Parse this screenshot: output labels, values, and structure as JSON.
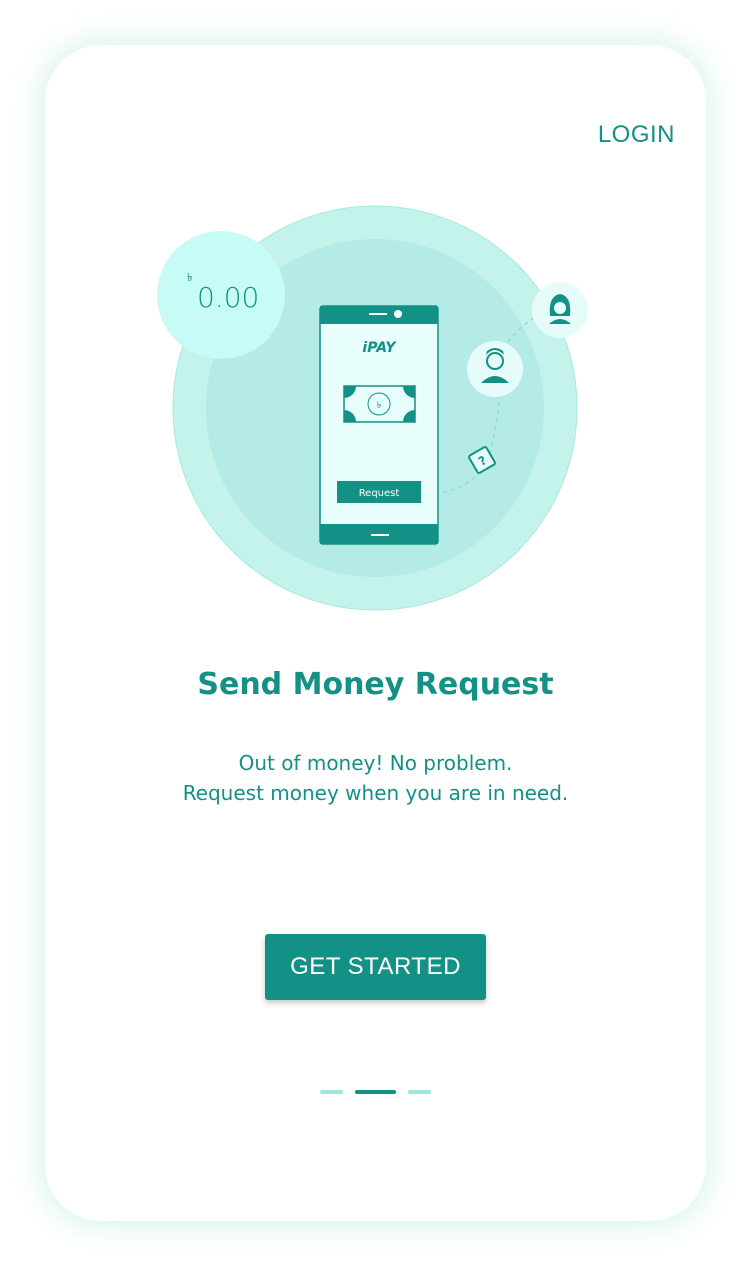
{
  "header": {
    "login_label": "LOGIN"
  },
  "balance": {
    "currency_symbol": "৳",
    "amount": "0.00"
  },
  "phone_screen": {
    "logo_text": "iPAY",
    "note_symbol": "৳",
    "request_label": "Request"
  },
  "onboarding": {
    "title": "Send Money Request",
    "description_line1": "Out of money! No problem.",
    "description_line2": "Request money when you are in need."
  },
  "cta": {
    "label": "GET STARTED"
  },
  "pager": {
    "total": 3,
    "active_index": 1
  },
  "colors": {
    "primary": "#139186",
    "circle_outer": "#c4f3ec",
    "circle_inner": "#b4ebe6",
    "bubble": "#c7fbf6",
    "pager_inactive": "#9ee5de"
  }
}
